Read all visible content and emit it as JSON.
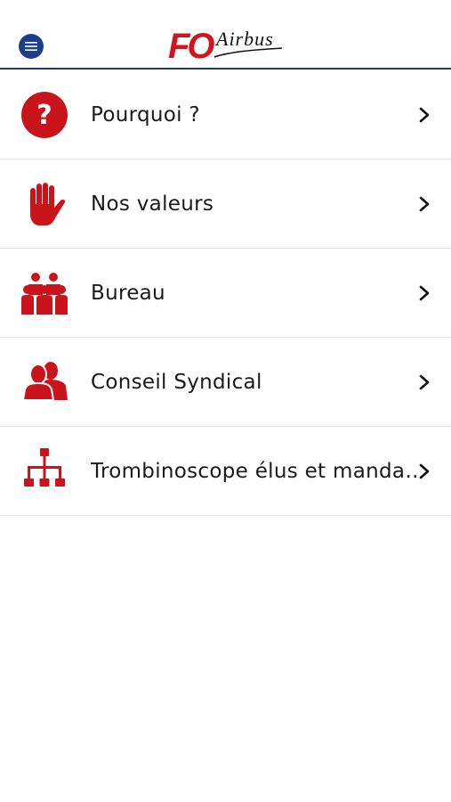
{
  "header": {
    "menu_icon": "hamburger-menu-icon",
    "logo_fo": "FO",
    "logo_airbus": "Airbus",
    "brand_red": "#d2141b",
    "brand_blue": "#1d3e8a"
  },
  "menu": {
    "items": [
      {
        "label": "Pourquoi ?",
        "icon": "question-mark-icon"
      },
      {
        "label": "Nos valeurs",
        "icon": "hand-icon"
      },
      {
        "label": "Bureau",
        "icon": "group-people-icon"
      },
      {
        "label": "Conseil Syndical",
        "icon": "two-people-icon"
      },
      {
        "label": "Trombinoscope élus et manda…",
        "icon": "org-chart-icon"
      }
    ]
  }
}
